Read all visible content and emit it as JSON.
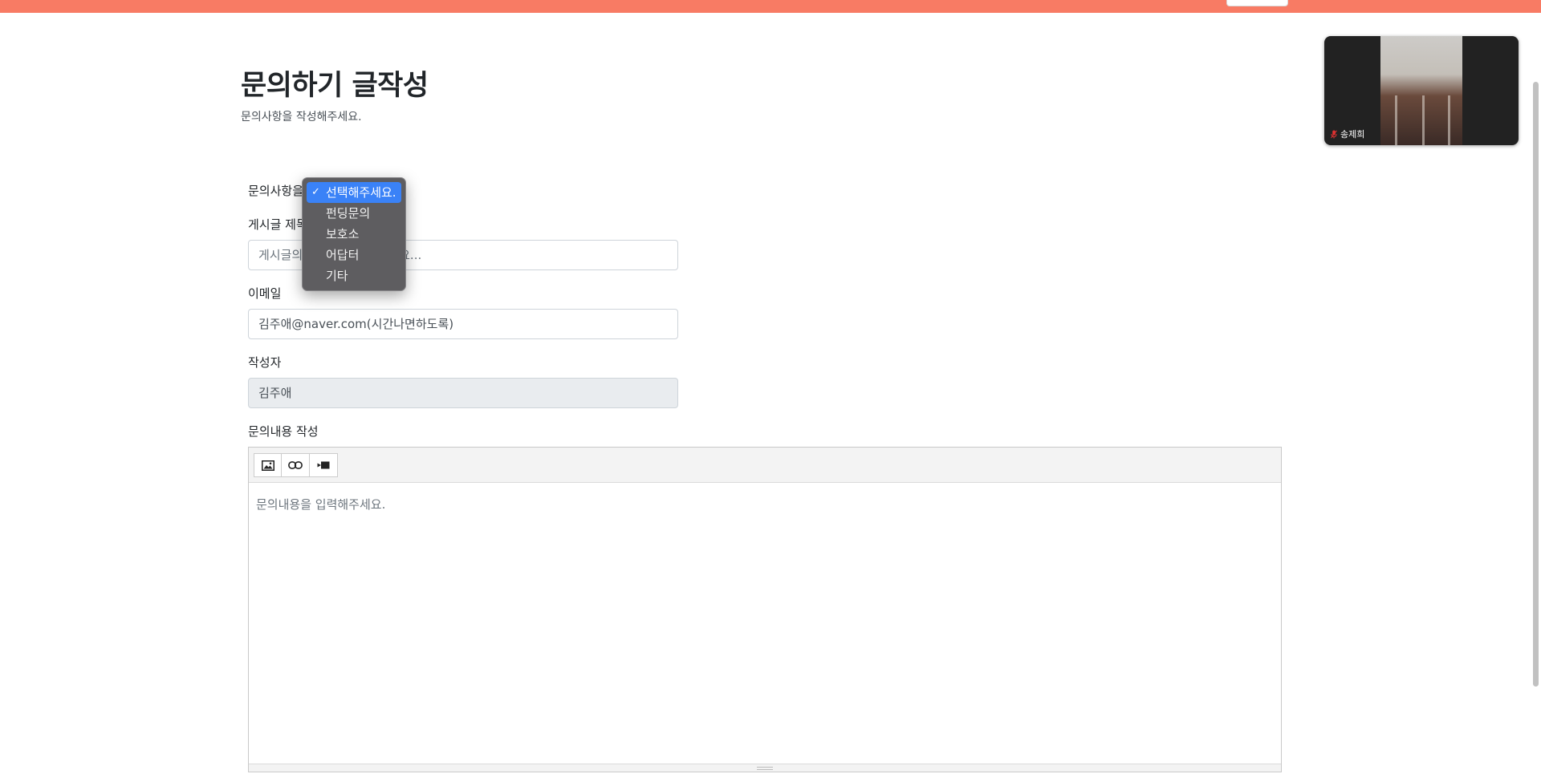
{
  "colors": {
    "topbar": "#f87b64",
    "dropdown_bg": "#5e5d60",
    "dropdown_selected": "#3a82f7"
  },
  "header": {
    "title": "문의하기 글작성",
    "subtitle": "문의사항을 작성해주세요."
  },
  "form": {
    "category_label": "문의사항을 선택",
    "title_label": "게시글 제목",
    "title_placeholder": "게시글의 제목을 입력해주세요...",
    "email_label": "이메일",
    "email_value": "김주애@naver.com(시간나면하도록)",
    "author_label": "작성자",
    "author_value": "김주애",
    "content_label": "문의내용 작성",
    "content_placeholder": "문의내용을 입력해주세요."
  },
  "dropdown": {
    "selected_check": "✓",
    "options": [
      "선택해주세요.",
      "펀딩문의",
      "보호소",
      "어답터",
      "기타"
    ],
    "selected_index": 0
  },
  "editor_toolbar": {
    "icons": [
      "image-icon",
      "link-icon",
      "video-icon"
    ]
  },
  "video_call": {
    "participant_name": "송제희",
    "mic_state": "muted"
  }
}
